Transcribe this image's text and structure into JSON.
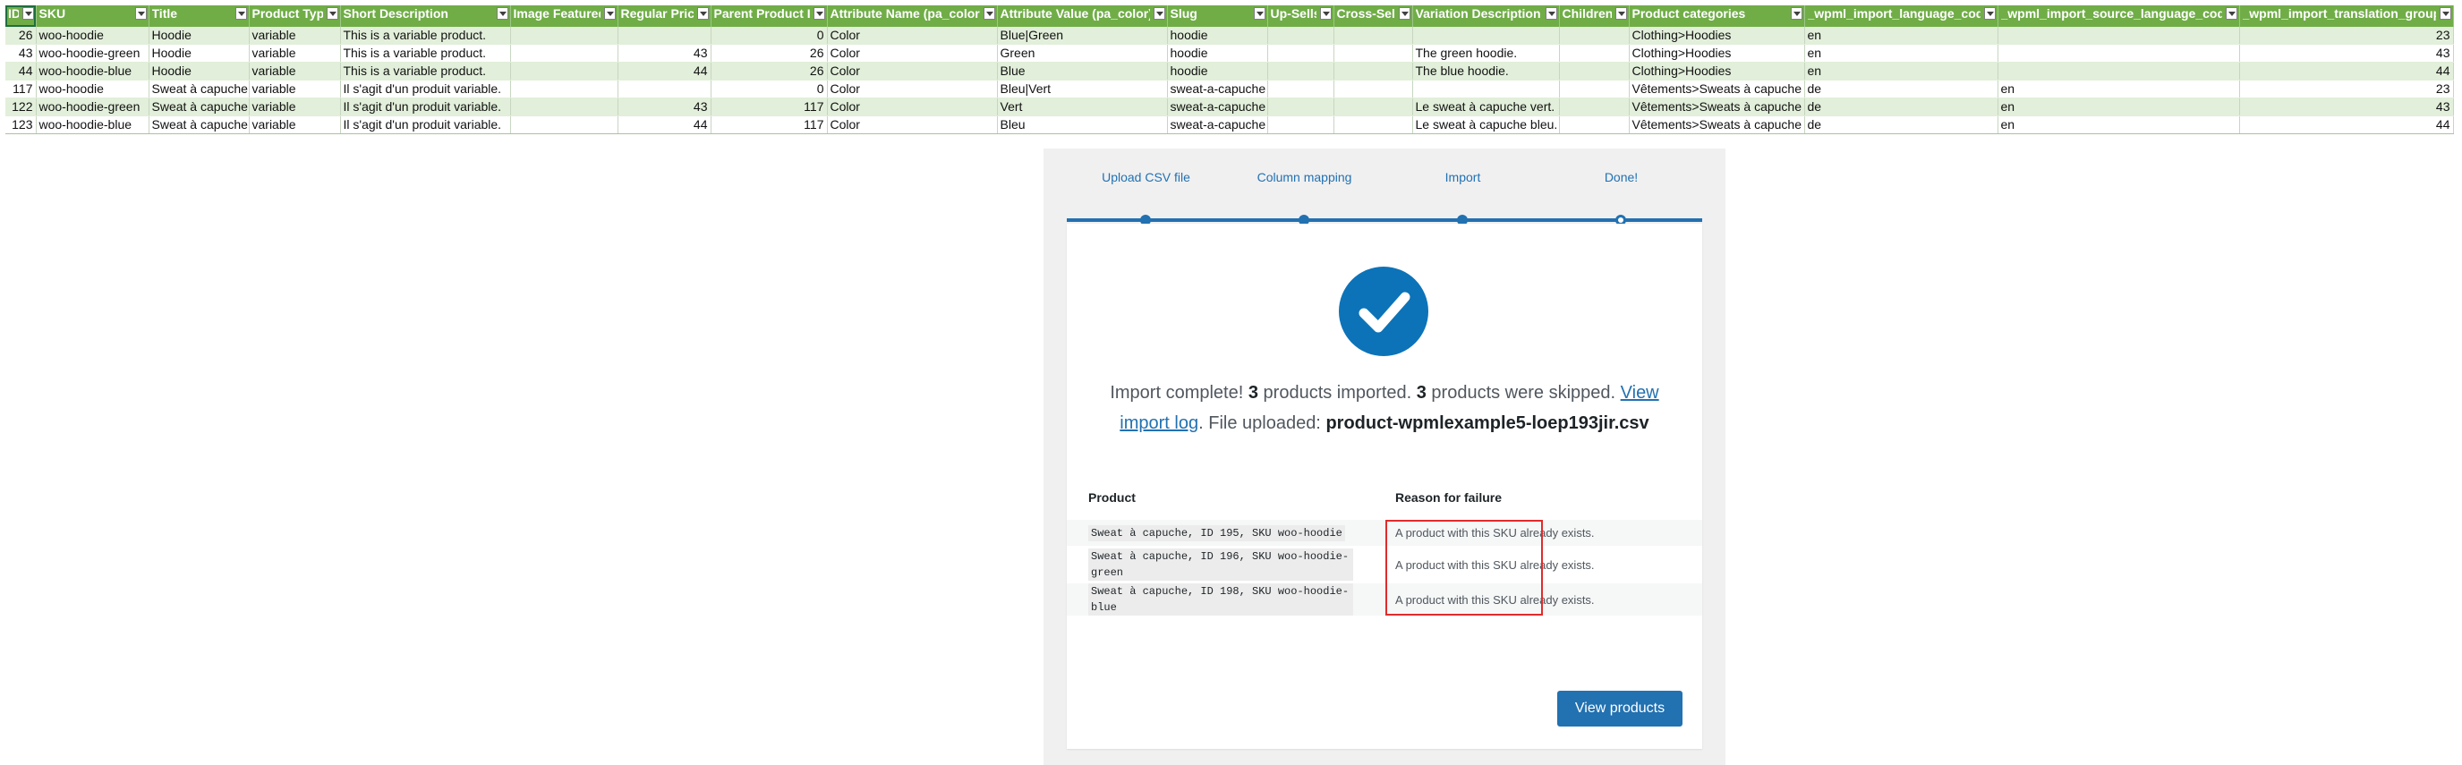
{
  "sheet": {
    "columns": [
      "ID",
      "SKU",
      "Title",
      "Product Type",
      "Short Description",
      "Image Featured",
      "Regular Price",
      "Parent Product ID",
      "Attribute Name (pa_color)",
      "Attribute Value (pa_color)",
      "Slug",
      "Up-Sells",
      "Cross-Sells",
      "Variation Description",
      "Children",
      "Product categories",
      "_wpml_import_language_code",
      "_wpml_import_source_language_code",
      "_wpml_import_translation_group"
    ],
    "rows": [
      [
        "26",
        "woo-hoodie",
        "Hoodie",
        "variable",
        "This is a variable product.",
        "",
        "",
        "0",
        "Color",
        "Blue|Green",
        "hoodie",
        "",
        "",
        "",
        "",
        "Clothing>Hoodies",
        "en",
        "",
        "23"
      ],
      [
        "43",
        "woo-hoodie-green",
        "Hoodie",
        "variable",
        "This is a variable product.",
        "",
        "43",
        "26",
        "Color",
        "Green",
        "hoodie",
        "",
        "",
        "The green hoodie.",
        "",
        "Clothing>Hoodies",
        "en",
        "",
        "43"
      ],
      [
        "44",
        "woo-hoodie-blue",
        "Hoodie",
        "variable",
        "This is a variable product.",
        "",
        "44",
        "26",
        "Color",
        "Blue",
        "hoodie",
        "",
        "",
        "The blue hoodie.",
        "",
        "Clothing>Hoodies",
        "en",
        "",
        "44"
      ],
      [
        "117",
        "woo-hoodie",
        "Sweat à capuche",
        "variable",
        "Il s'agit d'un produit variable.",
        "",
        "",
        "0",
        "Color",
        "Bleu|Vert",
        "sweat-a-capuche",
        "",
        "",
        "",
        "",
        "Vêtements>Sweats à capuche",
        "de",
        "en",
        "23"
      ],
      [
        "122",
        "woo-hoodie-green",
        "Sweat à capuche",
        "variable",
        "Il s'agit d'un produit variable.",
        "",
        "43",
        "117",
        "Color",
        "Vert",
        "sweat-a-capuche",
        "",
        "",
        "Le sweat à capuche vert.",
        "",
        "Vêtements>Sweats à capuche",
        "de",
        "en",
        "43"
      ],
      [
        "123",
        "woo-hoodie-blue",
        "Sweat à capuche",
        "variable",
        "Il s'agit d'un produit variable.",
        "",
        "44",
        "117",
        "Color",
        "Bleu",
        "sweat-a-capuche",
        "",
        "",
        "Le sweat à capuche bleu.",
        "",
        "Vêtements>Sweats à capuche",
        "de",
        "en",
        "44"
      ]
    ]
  },
  "importer": {
    "steps": [
      "Upload CSV file",
      "Column mapping",
      "Import",
      "Done!"
    ],
    "message": {
      "prefix": "Import complete! ",
      "imported_count": "3",
      "imported_text": " products imported. ",
      "skipped_count": "3",
      "skipped_text": " products were skipped. ",
      "log_link": "View import log",
      "file_label": ". File uploaded: ",
      "file_name": "product-wpmlexample5-loep193jir.csv"
    },
    "failures": {
      "product_header": "Product",
      "reason_header": "Reason for failure",
      "rows": [
        {
          "product": "Sweat à capuche, ID 195, SKU woo-hoodie",
          "reason": "A product with this SKU already exists."
        },
        {
          "product": "Sweat à capuche, ID 196, SKU woo-hoodie-green",
          "reason": "A product with this SKU already exists."
        },
        {
          "product": "Sweat à capuche, ID 198, SKU woo-hoodie-blue",
          "reason": "A product with this SKU already exists."
        }
      ]
    },
    "view_products_label": "View products"
  },
  "colors": {
    "header_green": "#70ad47",
    "band_green": "#e2efda",
    "wp_blue": "#2271b1",
    "check_blue": "#0c73b8",
    "highlight_red": "#e02b2b"
  }
}
